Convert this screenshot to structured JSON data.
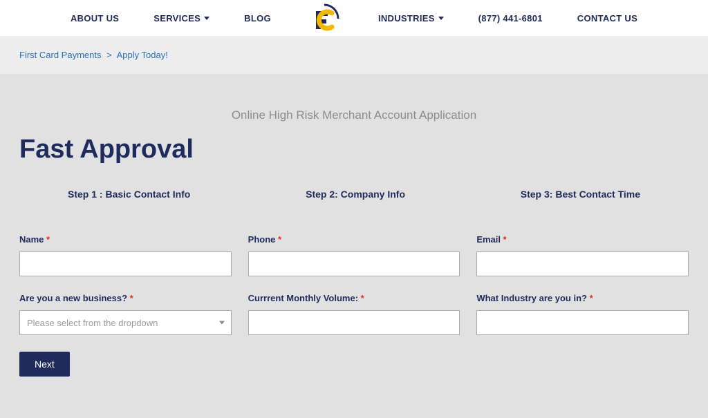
{
  "nav": {
    "about": "ABOUT US",
    "services": "SERVICES",
    "blog": "BLOG",
    "industries": "INDUSTRIES",
    "phone": "(877) 441-6801",
    "contact": "CONTACT US"
  },
  "breadcrumb": {
    "home": "First Card Payments",
    "separator": ">",
    "current": "Apply Today!"
  },
  "subtitle": "Online High Risk Merchant Account Application",
  "title": "Fast Approval",
  "steps": {
    "step1": "Step 1 : Basic Contact Info",
    "step2": "Step 2: Company Info",
    "step3": "Step 3: Best Contact Time"
  },
  "form": {
    "name_label": "Name",
    "phone_label": "Phone",
    "email_label": "Email",
    "new_business_label": "Are you a new business?",
    "monthly_volume_label": "Currrent Monthly Volume:",
    "industry_label": "What Industry are you in?",
    "dropdown_placeholder": "Please select from the dropdown",
    "required_marker": "*",
    "next_button": "Next"
  }
}
